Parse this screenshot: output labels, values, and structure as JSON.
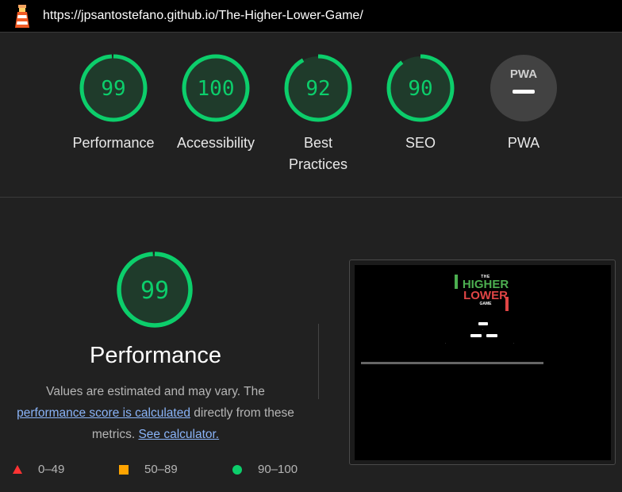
{
  "header": {
    "url": "https://jpsantostefano.github.io/The-Higher-Lower-Game/"
  },
  "scores": [
    {
      "label": "Performance",
      "value": "99",
      "fraction": 0.99
    },
    {
      "label": "Accessibility",
      "value": "100",
      "fraction": 1.0
    },
    {
      "label": "Best Practices",
      "value": "92",
      "fraction": 0.92
    },
    {
      "label": "SEO",
      "value": "90",
      "fraction": 0.9
    },
    {
      "label": "PWA",
      "value": "PWA"
    }
  ],
  "performance": {
    "score": "99",
    "fraction": 0.99,
    "title": "Performance",
    "desc_prefix": "Values are estimated and may vary. The",
    "link_score": "performance score is calculated",
    "desc_middle": "directly from these metrics.",
    "link_calc": "See calculator."
  },
  "legend": {
    "fail": "0–49",
    "average": "50–89",
    "pass": "90–100"
  },
  "colors": {
    "pass": "#0cce6b",
    "average": "#ffa400",
    "fail": "#ff3333",
    "link": "#8ab4f8"
  },
  "screenshot": {
    "game_the": "THE",
    "game_higher": "HIGHER",
    "game_lower": "LOWER",
    "game_game": "GAME"
  }
}
